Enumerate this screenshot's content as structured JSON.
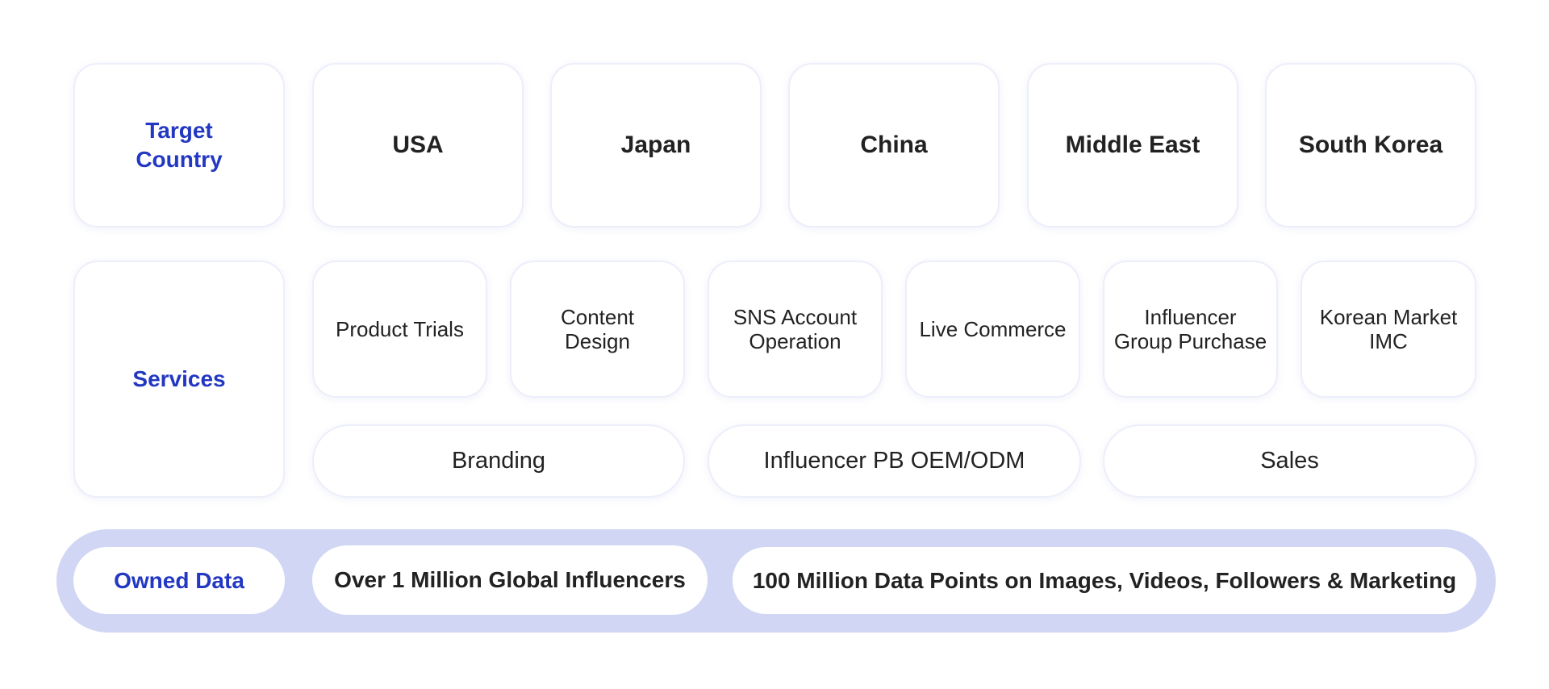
{
  "target_country": {
    "label_line1": "Target",
    "label_line2": "Country",
    "countries": [
      "USA",
      "Japan",
      "China",
      "Middle East",
      "South Korea"
    ]
  },
  "services": {
    "label": "Services",
    "items": [
      {
        "line1": "Product Trials",
        "line2": ""
      },
      {
        "line1": "Content",
        "line2": "Design"
      },
      {
        "line1": "SNS Account",
        "line2": "Operation"
      },
      {
        "line1": "Live Commerce",
        "line2": ""
      },
      {
        "line1": "Influencer",
        "line2": "Group Purchase"
      },
      {
        "line1": "Korean Market",
        "line2": "IMC"
      }
    ],
    "wide_items": [
      "Branding",
      "Influencer PB OEM/ODM",
      "Sales"
    ]
  },
  "owned_data": {
    "label": "Owned Data",
    "items": [
      "Over 1 Million Global Influencers",
      "100 Million Data Points on Images, Videos, Followers & Marketing"
    ]
  },
  "colors": {
    "accent_blue": "#2338c2",
    "band_lavender": "#d1d6f4",
    "card_border": "#eceefa"
  }
}
